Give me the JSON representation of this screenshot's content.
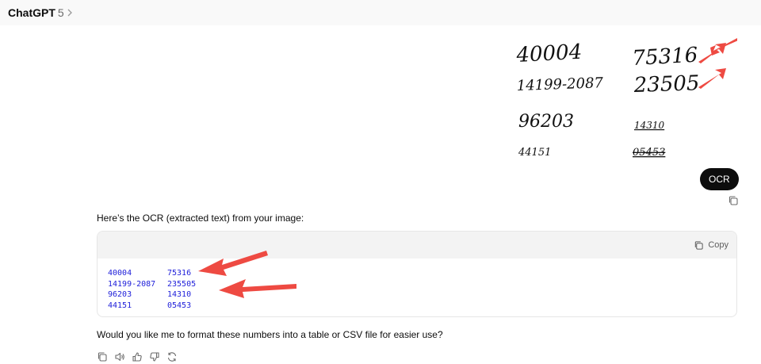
{
  "header": {
    "model_name": "ChatGPT",
    "model_version": "5"
  },
  "conversation": {
    "user_message": {
      "image_text": {
        "rows": [
          [
            "40004",
            "75316"
          ],
          [
            "14199-2087",
            "23505"
          ],
          [
            "96203",
            "14310"
          ],
          [
            "44151",
            "05453"
          ]
        ]
      },
      "text": "OCR"
    },
    "assistant_message": {
      "intro": "Here’s the OCR (extracted text) from your image:",
      "code_block": {
        "copy_label": "Copy",
        "rows": [
          [
            "40004",
            "75316"
          ],
          [
            "14199-2087",
            "235505"
          ],
          [
            "96203",
            "14310"
          ],
          [
            "44151",
            "05453"
          ]
        ]
      },
      "followup": "Would you like me to format these numbers into a table or CSV file for easier use?"
    }
  },
  "icons": {
    "copy": "copy-icon",
    "read_aloud": "speaker-icon",
    "like": "thumbs-up-icon",
    "dislike": "thumbs-down-icon",
    "regenerate": "regenerate-icon"
  },
  "colors": {
    "topbar_bg": "#f9f9f9",
    "bubble_bg": "#0d0d0d",
    "code_text": "#1d1dd9",
    "annotation_arrow": "#ee4a42"
  }
}
